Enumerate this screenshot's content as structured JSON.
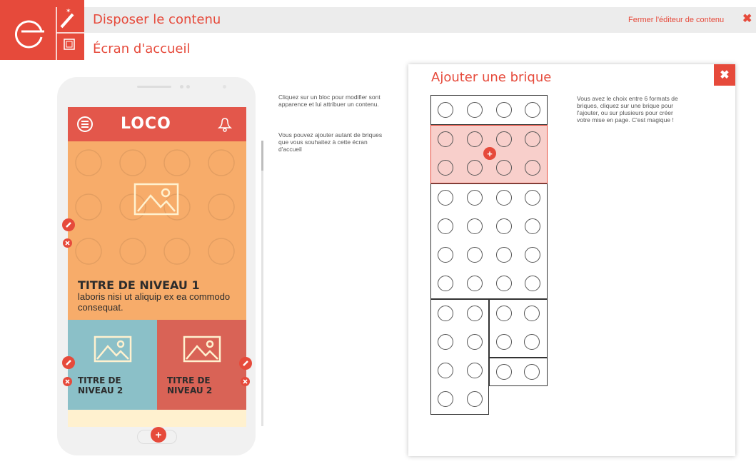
{
  "header": {
    "title": "Disposer le contenu",
    "subtitle": "Écran d'accueil",
    "close_editor": "Fermer l'éditeur de contenu",
    "close_symbol": "✖",
    "brand_color": "#e64a3b"
  },
  "phone": {
    "app_logo": "LOCO",
    "level1": {
      "title": "TITRE DE NIVEAU 1",
      "text": "laboris nisi ut aliquip ex ea commodo consequat."
    },
    "level2": [
      {
        "title_line1": "TITRE DE",
        "title_line2": "NIVEAU 2"
      },
      {
        "title_line1": "TITRE DE",
        "title_line2": "NIVEAU 2"
      }
    ],
    "add_symbol": "+"
  },
  "help": {
    "p1": "Cliquez sur un bloc pour modifier sont apparence et lui attribuer un contenu.",
    "p2": "Vous pouvez ajouter autant de briques que vous souhaitez à cette écran d'accueil"
  },
  "modal": {
    "title": "Ajouter une brique",
    "close_symbol": "✖",
    "help_text": "Vous avez le choix entre 6 formats de briques, cliquez sur une brique pour l'ajouter, ou sur plusieurs pour créer votre mise en page. C'est magique !",
    "add_symbol": "+"
  }
}
